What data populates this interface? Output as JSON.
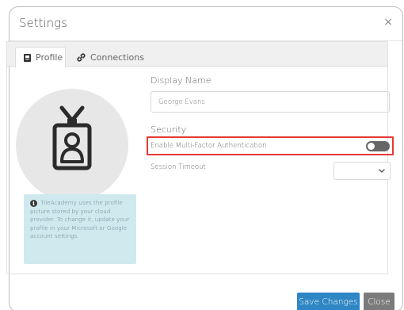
{
  "modal": {
    "title": "Settings",
    "close_glyph": "×"
  },
  "tabs": [
    {
      "label": "Profile",
      "icon": "id-badge-icon",
      "active": true
    },
    {
      "label": "Connections",
      "icon": "link-icon",
      "active": false
    }
  ],
  "profile": {
    "avatar_icon": "id-badge-icon",
    "info_icon": "info-icon",
    "info_text": "TileAcademy uses the profile picture stored by your cloud provider. To change it, update your profile in your Microsoft or Google account settings.",
    "display_name_label": "Display Name",
    "display_name_value": "George Evans",
    "security_heading": "Security",
    "mfa_label": "Enable Multi-Factor Authentication",
    "mfa_enabled": false,
    "session_timeout_label": "Session Timeout",
    "session_timeout_value": ""
  },
  "footer": {
    "save_label": "Save Changes",
    "close_label": "Close"
  },
  "colors": {
    "primary": "#2f86c4",
    "secondary": "#7b7b7b",
    "highlight": "#e53935",
    "info_bg": "#cfe9ef"
  }
}
